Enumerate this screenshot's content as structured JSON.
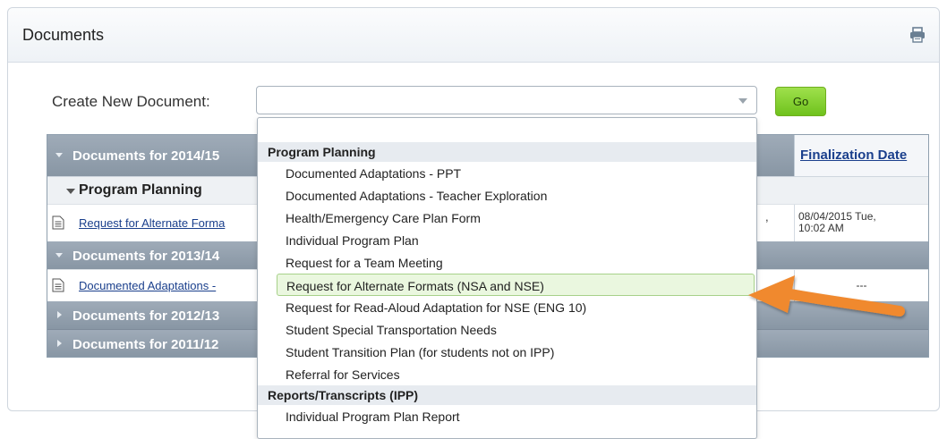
{
  "panel": {
    "title": "Documents",
    "print_icon": "print-icon"
  },
  "create": {
    "label": "Create New Document:",
    "select_value": "",
    "go_label": "Go"
  },
  "table": {
    "finalization_header": "Finalization Date",
    "rows": [
      {
        "year": "Documents for 2014/15"
      },
      {
        "section": "Program Planning"
      },
      {
        "doc": "Request for Alternate Forma",
        "date_line1": "08/04/2015 Tue,",
        "date_line2": "10:02 AM"
      },
      {
        "year": "Documents for 2013/14"
      },
      {
        "doc": "Documented Adaptations -",
        "date": "---"
      },
      {
        "year": "Documents for 2012/13"
      },
      {
        "year": "Documents for 2011/12"
      }
    ]
  },
  "dropdown": {
    "groups": [
      {
        "label": "Program Planning",
        "options": [
          "Documented Adaptations - PPT",
          "Documented Adaptations - Teacher Exploration",
          "Health/Emergency Care Plan Form",
          "Individual Program Plan",
          "Request for a Team Meeting",
          "Request for Alternate Formats (NSA and NSE)",
          "Request for Read-Aloud Adaptation for NSE (ENG 10)",
          "Student Special Transportation Needs",
          "Student Transition Plan (for students not on IPP)",
          "Referral for Services"
        ],
        "highlighted_index": 5
      },
      {
        "label": "Reports/Transcripts (IPP)",
        "options": [
          "Individual Program Plan Report"
        ]
      }
    ]
  },
  "colors": {
    "year_row": "#8896a4",
    "go_button": "#6fc21d",
    "highlight": "#eaf7df",
    "arrow": "#f0892e",
    "link": "#1a3f8c"
  }
}
